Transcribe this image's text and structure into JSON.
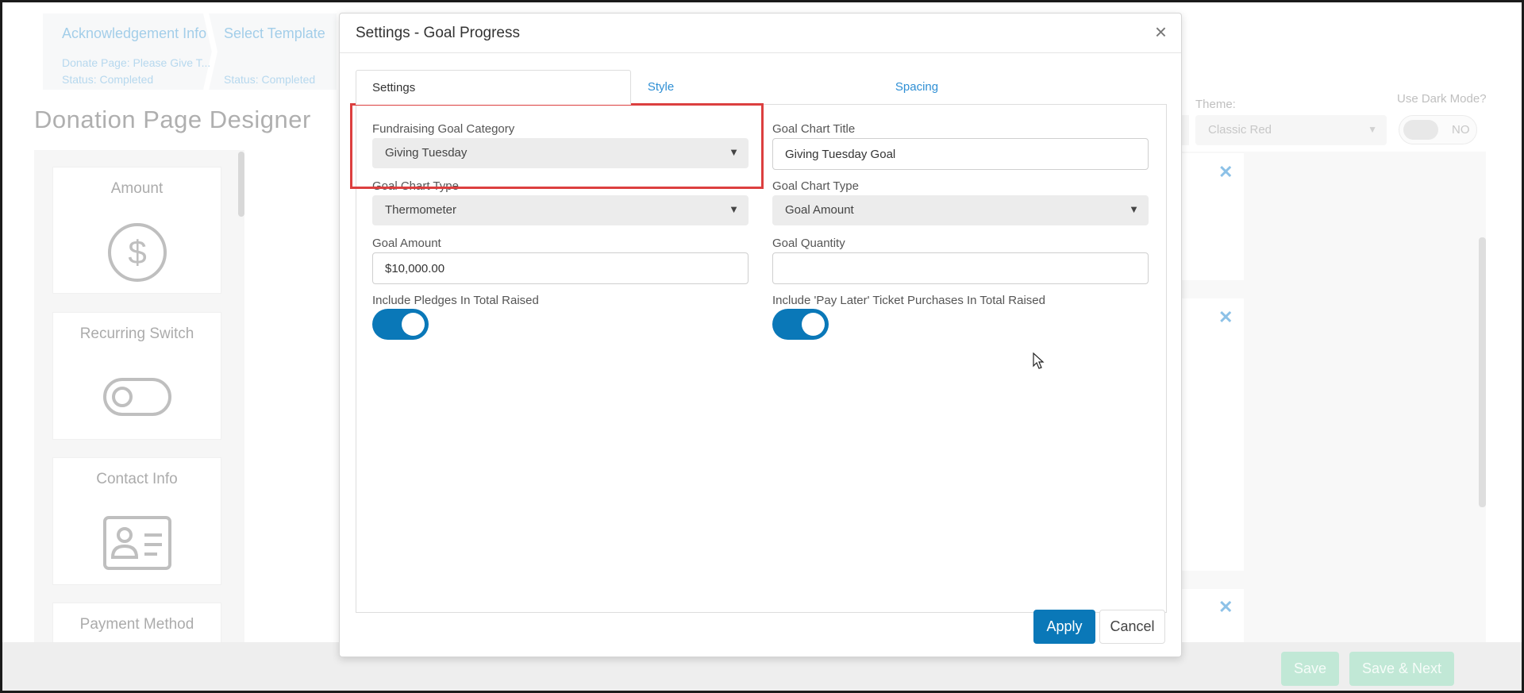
{
  "background": {
    "wizard": {
      "step1": "Acknowledgement Info",
      "step1_sub": "Donate Page: Please Give T...",
      "step1_status": "Status: Completed",
      "step2": "Select Template",
      "step2_status": "Status: Completed"
    },
    "page_title": "Donation Page Designer",
    "palette_items": [
      {
        "label": "Amount",
        "icon": "dollar-circle-icon"
      },
      {
        "label": "Recurring Switch",
        "icon": "toggle-switch-icon"
      },
      {
        "label": "Contact Info",
        "icon": "contact-card-icon"
      },
      {
        "label": "Payment Method",
        "icon": ""
      }
    ],
    "theme_label": "Theme:",
    "theme_value": "Classic Red",
    "dark_mode_label": "Use Dark Mode?",
    "dark_mode_value": "NO",
    "footer": {
      "save": "Save",
      "save_next": "Save & Next"
    }
  },
  "modal": {
    "title": "Settings - Goal Progress",
    "close_symbol": "×",
    "tabs": [
      "Settings",
      "Style",
      "Spacing"
    ],
    "active_tab": "Settings",
    "fields": {
      "fundraising_goal_category": {
        "label": "Fundraising Goal Category",
        "value": "Giving Tuesday"
      },
      "goal_chart_title": {
        "label": "Goal Chart Title",
        "value": "Giving Tuesday Goal"
      },
      "goal_chart_type": {
        "label": "Goal Chart Type",
        "value": "Thermometer"
      },
      "goal_chart_type_2": {
        "label": "Goal Chart Type",
        "value": "Goal Amount"
      },
      "goal_amount": {
        "label": "Goal Amount",
        "value": "$10,000.00"
      },
      "goal_quantity": {
        "label": "Goal Quantity",
        "value": ""
      },
      "include_pledges": {
        "label": "Include Pledges In Total Raised",
        "on": true
      },
      "include_pay_later": {
        "label": "Include 'Pay Later' Ticket Purchases In Total Raised",
        "on": true
      }
    },
    "buttons": {
      "apply": "Apply",
      "cancel": "Cancel"
    }
  },
  "colors": {
    "accent": "#0a78b8",
    "link": "#2f8fd4",
    "highlight": "#dc3f3f",
    "save_button": "#8fd6b4"
  }
}
